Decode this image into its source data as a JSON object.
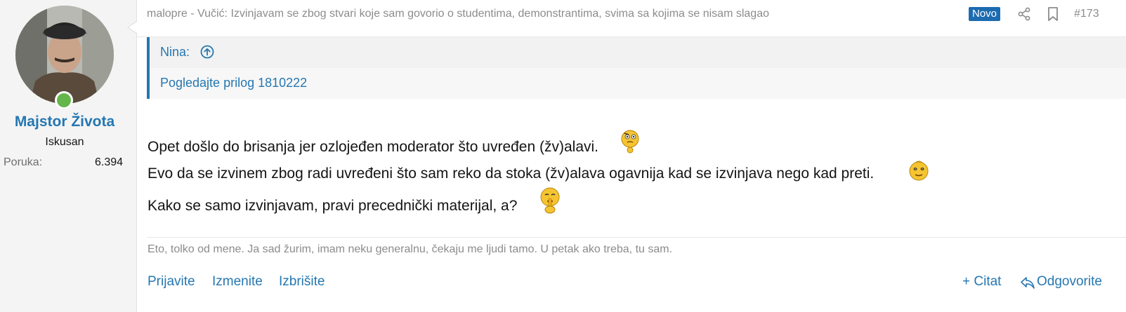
{
  "author": {
    "username": "Majstor Života",
    "user_title": "Iskusan",
    "stats": {
      "label": "Poruka:",
      "value": "6.394"
    },
    "online": true
  },
  "header": {
    "title": "malopre - Vučić: Izvinjavam se zbog stvari koje sam govorio o studentima, demonstrantima, svima sa kojima se nisam slagao",
    "badge": "Novo",
    "post_number": "#173",
    "icons": [
      "share-icon",
      "bookmark-icon"
    ]
  },
  "quote": {
    "author": "Nina:",
    "body": "Pogledajte prilog 1810222"
  },
  "message": {
    "lines": [
      {
        "text": "Opet došlo do brisanja jer ozlojeđen moderator što uvređen (žv)alavi.",
        "smiley": "thinking-smiley-icon"
      },
      {
        "text": "Evo da se izvinem zbog radi uvređeni što sam reko da stoka (žv)alava ogavnija kad se izvinjava nego kad preti.",
        "smiley": "dizzy-smiley-icon"
      },
      {
        "text": "Kako se samo izvinjavam, pravi precednički materijal, a?",
        "smiley": "shushing-smiley-icon"
      }
    ]
  },
  "signature": "Eto, tolko od mene. Ja sad žurim, imam neku generalnu, čekaju me ljudi tamo. U petak ako treba, tu sam.",
  "actions": {
    "report": "Prijavite",
    "edit": "Izmenite",
    "delete": "Izbrišite",
    "quote": "+ Citat",
    "reply": "Odgovorite"
  },
  "colors": {
    "link": "#2577b1",
    "badge": "#1d6bb0",
    "online": "#63b64a",
    "sidebar": "#f4f4f4"
  }
}
